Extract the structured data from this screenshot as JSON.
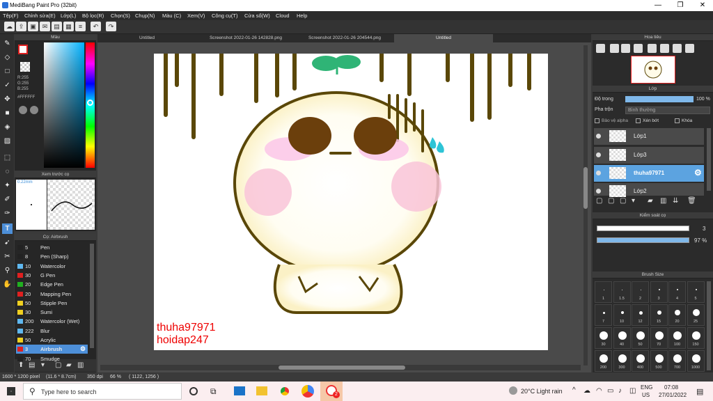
{
  "app": {
    "title": "MediBang Paint Pro (32bit)"
  },
  "menu": [
    "Tệp(F)",
    "Chỉnh sửa(E)",
    "Lớp(L)",
    "Bộ lọc(R)",
    "Chọn(S)",
    "Chụp(N)",
    "Màu (C)",
    "Xem(V)",
    "Công cụ(T)",
    "Cửa sổ(W)",
    "Cloud",
    "Help"
  ],
  "tabs": [
    "Untitled",
    "Screenshot 2022-01-26 142828.png",
    "Screenshot 2022-01-26 204544.png",
    "Untitled"
  ],
  "color_panel": {
    "title": "Màu",
    "r": "R:255",
    "g": "G:255",
    "b": "B:255",
    "hex": "#FFFFFF"
  },
  "preview_panel": {
    "title": "Xem trước cọ",
    "size": "0.22mm"
  },
  "brush_panel": {
    "title": "Cọ: Airbrush",
    "brushes": [
      {
        "size": "5",
        "name": "Pen",
        "color": "#222222"
      },
      {
        "size": "8",
        "name": "Pen (Sharp)",
        "color": "#222222"
      },
      {
        "size": "10",
        "name": "Watercolor",
        "color": "#5fb8f0"
      },
      {
        "size": "30",
        "name": "G Pen",
        "color": "#e02020"
      },
      {
        "size": "20",
        "name": "Edge Pen",
        "color": "#20b020"
      },
      {
        "size": "20",
        "name": "Mapping Pen",
        "color": "#e02020"
      },
      {
        "size": "50",
        "name": "Stipple Pen",
        "color": "#f0d020"
      },
      {
        "size": "30",
        "name": "Sumi",
        "color": "#f0d020"
      },
      {
        "size": "200",
        "name": "Watercolor (Wet)",
        "color": "#5fb8f0"
      },
      {
        "size": "222",
        "name": "Blur",
        "color": "#5fb8f0"
      },
      {
        "size": "50",
        "name": "Acrylic",
        "color": "#f0d020"
      },
      {
        "size": "3",
        "name": "Airbrush",
        "color": "#e02020"
      },
      {
        "size": "70",
        "name": "Smudge",
        "color": "#222222"
      }
    ]
  },
  "navigator": {
    "title": "Hoa tiêu"
  },
  "layer_panel": {
    "title": "Lớp",
    "opacity_label": "Độ trong",
    "opacity_value": "100 %",
    "blend_label": "Pha trộn",
    "blend_value": "Bình thường",
    "protect_alpha": "Bảo vệ alpha",
    "clipping": "Xén bớt",
    "lock": "Khóa",
    "layers": [
      {
        "name": "Lớp1"
      },
      {
        "name": "Lớp3"
      },
      {
        "name": "thuha97971"
      },
      {
        "name": "Lớp2"
      }
    ]
  },
  "brush_control": {
    "title": "Kiểm soát cọ",
    "size": "3",
    "opacity": "97 %"
  },
  "brush_size": {
    "title": "Brush Size",
    "sizes": [
      "1",
      "1.5",
      "2",
      "3",
      "4",
      "5",
      "7",
      "10",
      "12",
      "15",
      "20",
      "25",
      "30",
      "40",
      "50",
      "70",
      "100",
      "150",
      "200",
      "300",
      "400",
      "500",
      "700",
      "1000"
    ]
  },
  "canvas": {
    "watermark_line1": "thuha97971",
    "watermark_line2": "hoidap247"
  },
  "status": {
    "size": "1600 * 1200 pixel",
    "cm": "(11.6 * 8.7cm)",
    "dpi": "350 dpi",
    "zoom": "66 %",
    "coords": "( 1122, 1256 )"
  },
  "taskbar": {
    "search_placeholder": "Type here to search",
    "weather": "20°C  Light rain",
    "lang1": "ENG",
    "lang2": "US",
    "time": "07:08",
    "date": "27/01/2022",
    "badge": "2"
  }
}
